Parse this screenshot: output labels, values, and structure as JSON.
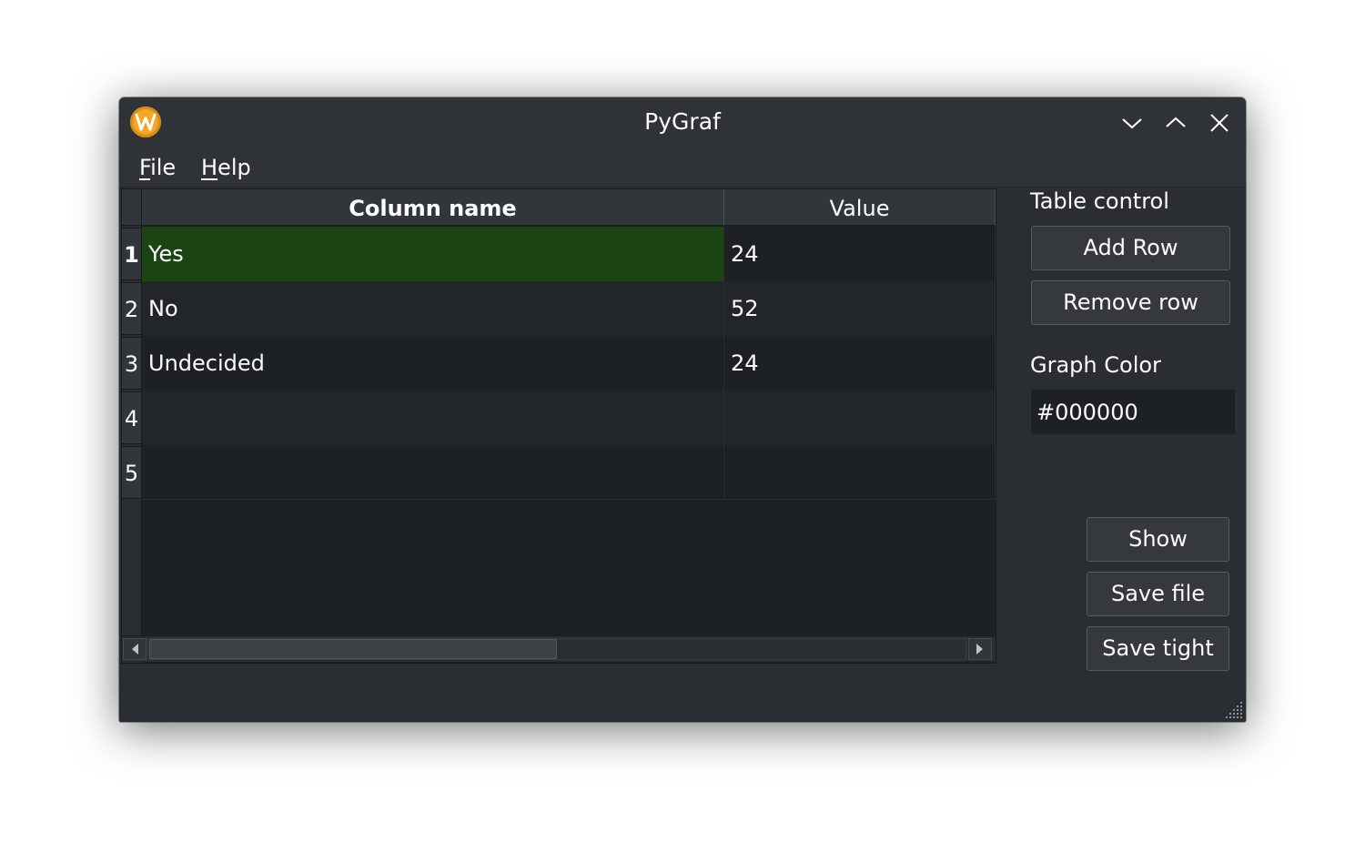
{
  "window": {
    "title": "PyGraf"
  },
  "menu": {
    "file": {
      "accel": "F",
      "rest": "ile"
    },
    "help": {
      "accel": "H",
      "rest": "elp"
    }
  },
  "table": {
    "headers": [
      "Column name",
      "Value"
    ],
    "row_numbers": [
      "1",
      "2",
      "3",
      "4",
      "5"
    ],
    "rows": [
      {
        "name": "Yes",
        "value": "24",
        "selected": true
      },
      {
        "name": "No",
        "value": "52"
      },
      {
        "name": "Undecided",
        "value": "24"
      },
      {
        "name": "",
        "value": ""
      },
      {
        "name": "",
        "value": ""
      }
    ],
    "horizontal_scroll_fraction": 0.5
  },
  "panel": {
    "table_control_label": "Table control",
    "add_row_label": "Add Row",
    "remove_row_label": "Remove row",
    "graph_color_label": "Graph Color",
    "graph_color_value": "#000000",
    "show_label": "Show",
    "save_file_label": "Save file",
    "save_tight_label": "Save tight"
  },
  "colors": {
    "window_bg": "#2a2e32",
    "selection": "#1a4512",
    "accent_icon": "#f5a623"
  },
  "icons": {
    "app": "app-logo-icon",
    "minimize": "chevron-down-icon",
    "maximize": "chevron-up-icon",
    "close": "close-icon",
    "scroll_left": "triangle-left-icon",
    "scroll_right": "triangle-right-icon",
    "resize": "resize-grip-icon"
  }
}
